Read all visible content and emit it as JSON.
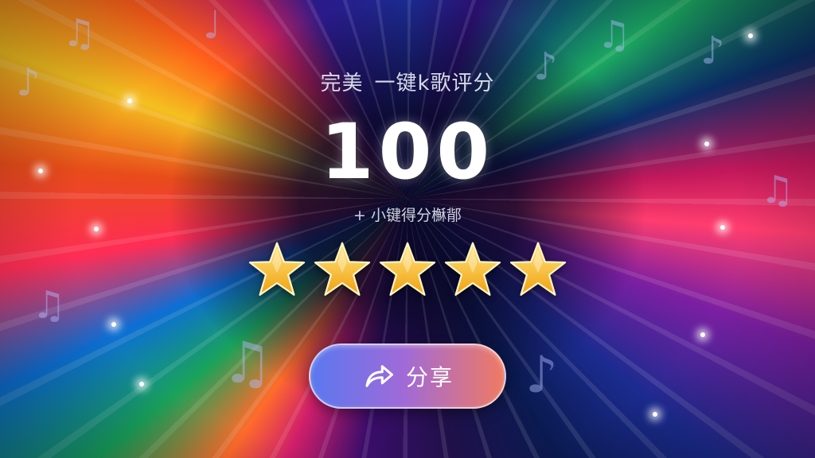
{
  "header": {
    "rating_label": "完美",
    "app_title": "一键k歌评分"
  },
  "score": {
    "value": "100",
    "bonus_text": "+ 小键得分櫯鄁"
  },
  "rating": {
    "stars_filled": 5,
    "stars_total": 5
  },
  "actions": {
    "share_label": "分享",
    "share_icon": "share-arrow-icon"
  },
  "colors": {
    "button_start": "#5a78f0",
    "button_mid": "#a06ad8",
    "button_end": "#f07a62",
    "star_top": "#ffe680",
    "star_bottom": "#f0a010"
  }
}
